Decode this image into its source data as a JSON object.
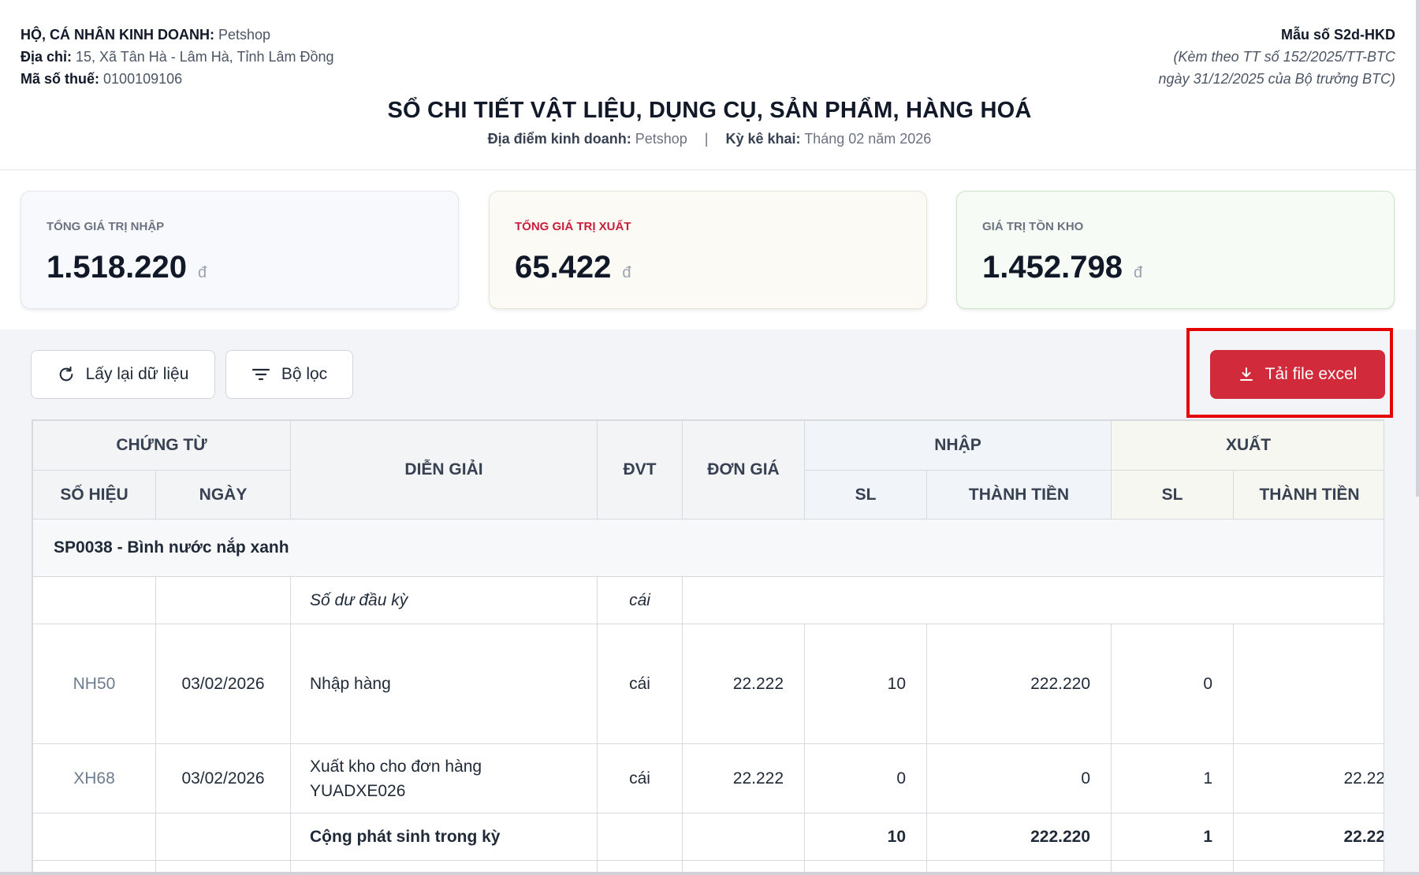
{
  "header": {
    "biz_label": "HỘ, CÁ NHÂN KINH DOANH:",
    "biz_value": "Petshop",
    "addr_label": "Địa chỉ:",
    "addr_value": "15, Xã Tân Hà - Lâm Hà, Tỉnh Lâm Đồng",
    "tax_label": "Mã số thuế:",
    "tax_value": "0100109106",
    "form_no": "Mẫu số S2d-HKD",
    "form_note_1": "(Kèm theo TT số 152/2025/TT-BTC",
    "form_note_2": "ngày 31/12/2025 của Bộ trưởng BTC)",
    "title": "SỔ CHI TIẾT VẬT LIỆU, DỤNG CỤ, SẢN PHẨM, HÀNG HOÁ",
    "location_label": "Địa điểm kinh doanh:",
    "location_value": "Petshop",
    "separator": "|",
    "period_label": "Kỳ kê khai:",
    "period_value": "Tháng 02 năm 2026"
  },
  "stats": {
    "import": {
      "label": "TỔNG GIÁ TRỊ NHẬP",
      "value": "1.518.220",
      "currency": "đ"
    },
    "export": {
      "label": "TỔNG GIÁ TRỊ XUẤT",
      "value": "65.422",
      "currency": "đ"
    },
    "stock": {
      "label": "GIÁ TRỊ TỒN KHO",
      "value": "1.452.798",
      "currency": "đ"
    }
  },
  "toolbar": {
    "reload_label": "Lấy lại dữ liệu",
    "filter_label": "Bộ lọc",
    "excel_label": "Tải file excel"
  },
  "table": {
    "headers": {
      "voucher": "CHỨNG TỪ",
      "voucher_no": "SỐ HIỆU",
      "voucher_date": "NGÀY",
      "description": "DIỄN GIẢI",
      "unit": "ĐVT",
      "unit_price": "ĐƠN GIÁ",
      "import": "NHẬP",
      "export": "XUẤT",
      "qty": "SL",
      "amount": "THÀNH TIỀN"
    },
    "group_title": "SP0038 - Bình nước nắp xanh",
    "opening": {
      "description": "Số dư đầu kỳ",
      "unit": "cái"
    },
    "rows": [
      {
        "no": "NH50",
        "date": "03/02/2026",
        "description": "Nhập hàng",
        "unit": "cái",
        "price": "22.222",
        "in_qty": "10",
        "in_amount": "222.220",
        "out_qty": "0",
        "out_amount": ""
      },
      {
        "no": "XH68",
        "date": "03/02/2026",
        "description_1": "Xuất kho cho đơn hàng",
        "description_2": "YUADXE026",
        "unit": "cái",
        "price": "22.222",
        "in_qty": "0",
        "in_amount": "0",
        "out_qty": "1",
        "out_amount": "22.22"
      }
    ],
    "total": {
      "description": "Cộng phát sinh trong kỳ",
      "in_qty": "10",
      "in_amount": "222.220",
      "out_qty": "1",
      "out_amount": "22.22"
    }
  },
  "colors": {
    "accent_red": "#d12a3b",
    "highlight": "#e60000",
    "export_label": "#c81e3c"
  }
}
